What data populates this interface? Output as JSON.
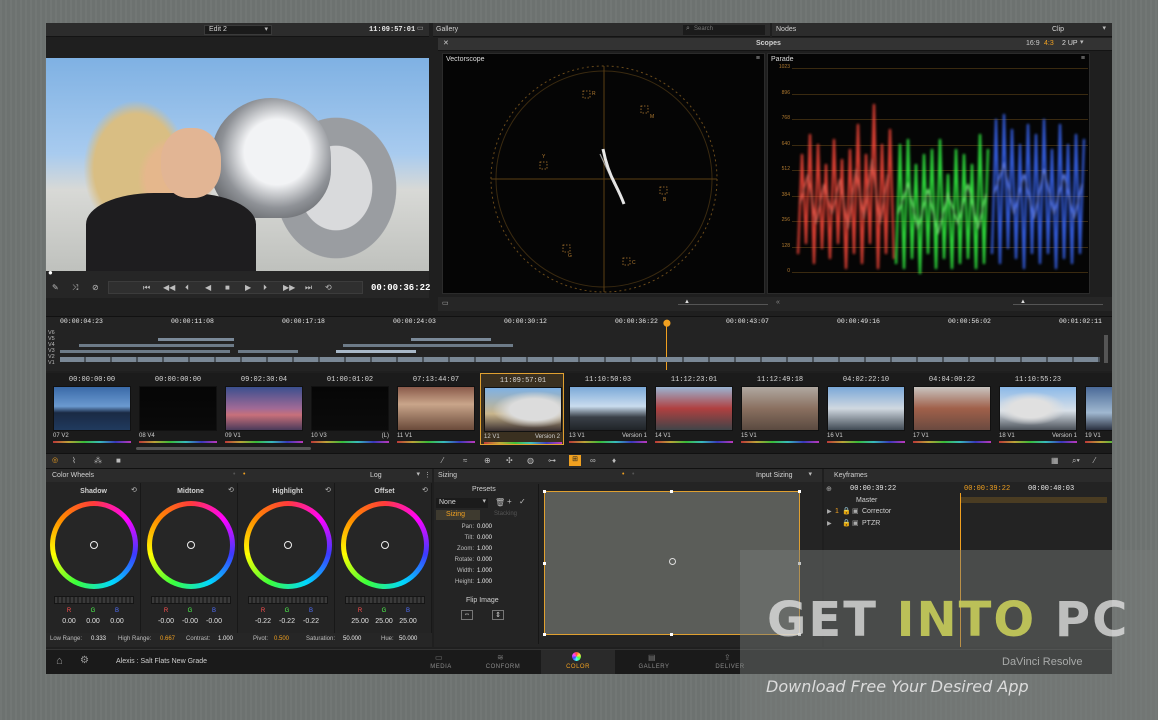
{
  "viewer": {
    "clip_name": "Edit 2",
    "source_tc": "11:09:57:01",
    "current_tc": "00:00:36:22"
  },
  "gallery": {
    "title": "Gallery",
    "search_placeholder": "Search"
  },
  "nodes": {
    "title": "Nodes",
    "mode": "Clip"
  },
  "scopes": {
    "title": "Scopes",
    "aspect_a": "16:9",
    "aspect_b": "4:3",
    "layout": "2 UP",
    "vectorscope_label": "Vectorscope",
    "parade_label": "Parade",
    "vs_targets": [
      "R",
      "M",
      "B",
      "C",
      "G",
      "Y"
    ],
    "parade_ticks": [
      "1023",
      "896",
      "768",
      "640",
      "512",
      "384",
      "256",
      "128",
      "0"
    ]
  },
  "timeline": {
    "ruler": [
      "00:00:04:23",
      "00:00:11:08",
      "00:00:17:18",
      "00:00:24:03",
      "00:00:30:12",
      "00:00:36:22",
      "00:00:43:07",
      "00:00:49:16",
      "00:00:56:02",
      "00:01:02:11"
    ],
    "tracks": [
      "V6",
      "V5",
      "V4",
      "V3",
      "V2",
      "V1"
    ]
  },
  "clips": [
    {
      "tc": "00:00:00:00",
      "label": "07 V2",
      "ver": ""
    },
    {
      "tc": "00:00:00:00",
      "label": "08 V4",
      "ver": ""
    },
    {
      "tc": "09:02:30:04",
      "label": "09 V1",
      "ver": ""
    },
    {
      "tc": "01:00:01:02",
      "label": "10 V3",
      "ver": "(L)"
    },
    {
      "tc": "07:13:44:07",
      "label": "11 V1",
      "ver": ""
    },
    {
      "tc": "11:09:57:01",
      "label": "12 V1",
      "ver": "Version 2"
    },
    {
      "tc": "11:10:50:03",
      "label": "13 V1",
      "ver": "Version 1"
    },
    {
      "tc": "11:12:23:01",
      "label": "14 V1",
      "ver": ""
    },
    {
      "tc": "11:12:49:18",
      "label": "15 V1",
      "ver": ""
    },
    {
      "tc": "04:02:22:10",
      "label": "16 V1",
      "ver": ""
    },
    {
      "tc": "04:04:00:22",
      "label": "17 V1",
      "ver": ""
    },
    {
      "tc": "11:10:55:23",
      "label": "18 V1",
      "ver": "Version 1"
    },
    {
      "tc": "11:0",
      "label": "19 V1",
      "ver": ""
    }
  ],
  "color_wheels": {
    "title": "Color Wheels",
    "mode": "Log",
    "wheels": [
      {
        "name": "Shadow",
        "r": "0.00",
        "g": "0.00",
        "b": "0.00"
      },
      {
        "name": "Midtone",
        "r": "-0.00",
        "g": "-0.00",
        "b": "-0.00"
      },
      {
        "name": "Highlight",
        "r": "-0.22",
        "g": "-0.22",
        "b": "-0.22"
      },
      {
        "name": "Offset",
        "r": "25.00",
        "g": "25.00",
        "b": "25.00"
      }
    ],
    "channel_labels": {
      "r": "R",
      "g": "G",
      "b": "B"
    },
    "params": {
      "low_range_label": "Low Range:",
      "low_range": "0.333",
      "high_range_label": "High Range:",
      "high_range": "0.667",
      "contrast_label": "Contrast:",
      "contrast": "1.000",
      "pivot_label": "Pivot:",
      "pivot": "0.500",
      "saturation_label": "Saturation:",
      "saturation": "50.000",
      "hue_label": "Hue:",
      "hue": "50.000"
    }
  },
  "sizing": {
    "title": "Sizing",
    "mode": "Input Sizing",
    "presets_label": "Presets",
    "preset_value": "None",
    "tab_active": "Sizing",
    "tab_inactive": "Stacking",
    "fields": [
      {
        "label": "Pan:",
        "value": "0.000"
      },
      {
        "label": "Tilt:",
        "value": "0.000"
      },
      {
        "label": "Zoom:",
        "value": "1.000"
      },
      {
        "label": "Rotate:",
        "value": "0.000"
      },
      {
        "label": "Width:",
        "value": "1.000"
      },
      {
        "label": "Height:",
        "value": "1.000"
      }
    ],
    "flip_label": "Flip Image"
  },
  "keyframes": {
    "title": "Keyframes",
    "tc_a": "00:00:39:22",
    "tc_b": "00:00:39:22",
    "tc_c": "00:00:40:03",
    "master": "Master",
    "rows": [
      {
        "num": "1",
        "name": "Corrector"
      },
      {
        "num": "",
        "name": "PTZR"
      }
    ]
  },
  "statusbar": {
    "project": "Alexis : Salt Flats New Grade",
    "pages": [
      "MEDIA",
      "CONFORM",
      "COLOR",
      "GALLERY",
      "DELIVER"
    ],
    "active_page": "COLOR",
    "brand": "DaVinci Resolve"
  },
  "watermark": {
    "main_a": "GET ",
    "main_b": "INTO",
    "main_c": " PC",
    "tagline": "Download Free Your Desired App"
  },
  "colors": {
    "accent": "#f0a020",
    "parade_red": "#ff4a3a",
    "parade_green": "#35ff45",
    "parade_blue": "#3a6bff"
  }
}
